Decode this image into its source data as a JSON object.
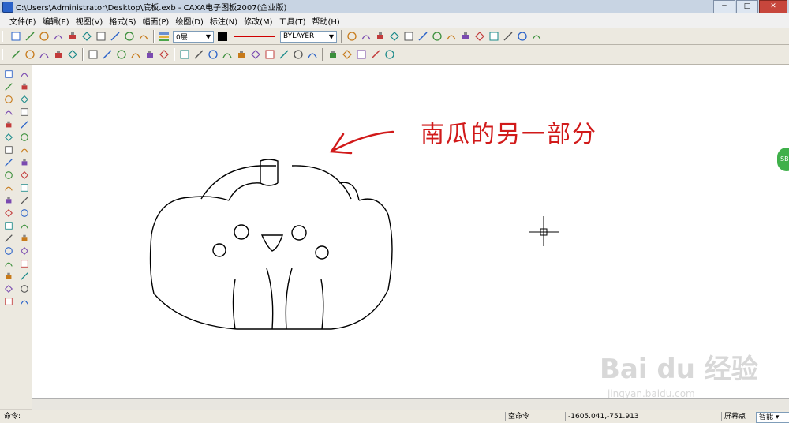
{
  "window": {
    "title": "C:\\Users\\Administrator\\Desktop\\底板.exb - CAXA电子图板2007(企业版)",
    "minimize": "─",
    "maximize": "□",
    "close": "✕"
  },
  "menu": [
    "文件(F)",
    "编辑(E)",
    "视图(V)",
    "格式(S)",
    "幅面(P)",
    "绘图(D)",
    "标注(N)",
    "修改(M)",
    "工具(T)",
    "帮助(H)"
  ],
  "properties": {
    "layer": "0层",
    "linetype": "BYLAYER",
    "line_color": "#d00000",
    "fill_color": "#000000"
  },
  "annotation": {
    "text": "南瓜的另一部分",
    "color": "#d11a1a"
  },
  "side_badge": "SB",
  "watermark": {
    "main": "Bai du 经验",
    "sub": "jingyan.baidu.com"
  },
  "status": {
    "command_label": "命令:",
    "empty_command": "空命令",
    "coordinates": "-1605.041,-751.913",
    "screen_point": "屏幕点",
    "mode": "智能"
  },
  "icons": {
    "toolbar1": [
      "new-file-icon",
      "open-folder-icon",
      "save-icon",
      "print-icon",
      "cut-icon",
      "copy-icon",
      "paste-icon",
      "undo-icon",
      "redo-icon",
      "help-icon",
      "layer-icon"
    ],
    "toolbar1_right": [
      "arc-tool-icon",
      "dimension-icon",
      "zoom-icon",
      "pan-icon",
      "view-icon",
      "properties-icon",
      "block-icon",
      "image-icon",
      "table-icon",
      "frame-icon",
      "title-block-icon",
      "parts-icon",
      "bom-icon",
      "library-icon"
    ],
    "toolbar2": [
      "snap-icon",
      "window-icon",
      "view-fit-icon",
      "text-icon",
      "font-icon",
      "multiline-icon",
      "curve-icon",
      "spline-icon",
      "break-icon",
      "offset-icon",
      "center-icon",
      "dim-linear-icon",
      "dim-aligned-icon",
      "dim-angle-icon",
      "dim-radius-icon",
      "leader-icon",
      "tolerance-icon",
      "datum-icon",
      "roughness-icon",
      "weld-icon",
      "hatch-icon",
      "zoom-window-icon",
      "zoom-all-icon",
      "zoom-in-icon",
      "zoom-out-icon",
      "zoom-previous-icon"
    ],
    "left_col1": [
      "line-icon",
      "parallel-line-icon",
      "circle-icon",
      "arc-icon",
      "spline-icon",
      "point-icon",
      "ellipse-icon",
      "rectangle-icon",
      "polygon-icon",
      "polyline-icon",
      "chamfer-icon",
      "axis-icon",
      "hatch-icon",
      "image-icon",
      "text-icon",
      "leader-icon",
      "block-icon",
      "attribute-icon",
      "table-icon"
    ],
    "left_col2": [
      "eraser-icon",
      "move-icon",
      "copy-icon",
      "mirror-icon",
      "rotate-icon",
      "array-icon",
      "scale-icon",
      "trim-icon",
      "fillet-icon",
      "extend-icon",
      "break-icon",
      "stretch-icon",
      "explode-icon",
      "align-icon",
      "cut-icon",
      "measure-icon",
      "dimension-icon",
      "edit-icon",
      "property-icon"
    ]
  }
}
